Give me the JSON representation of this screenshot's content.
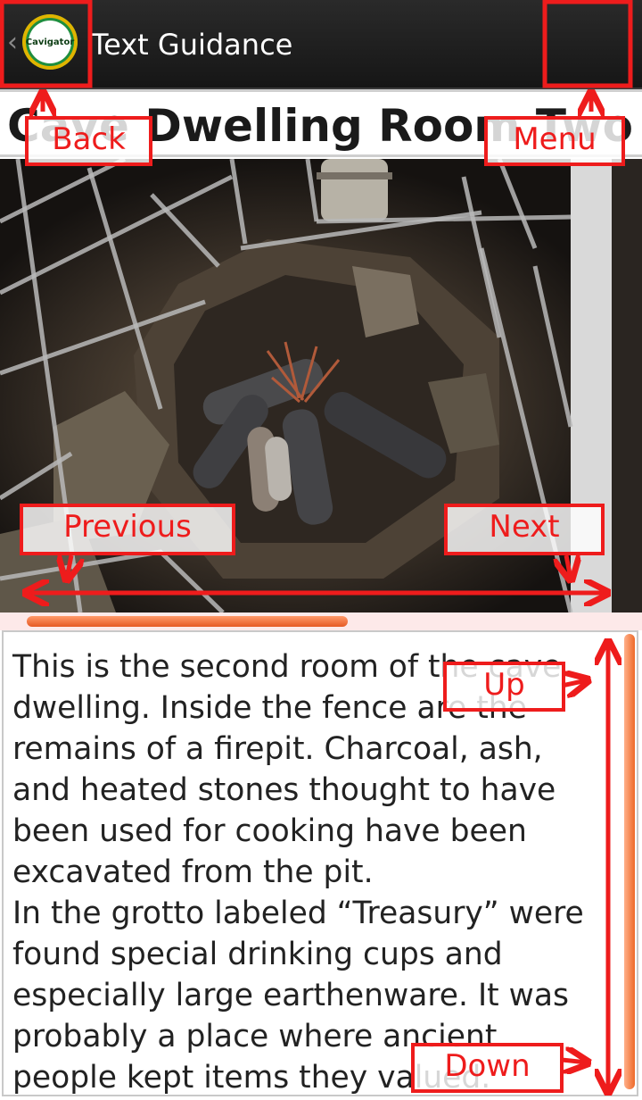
{
  "actionbar": {
    "title": "Text Guidance",
    "logo_text": "Cavigator",
    "back_icon": "chevron-left-icon",
    "menu_icon": "overflow-menu-icon"
  },
  "section": {
    "title": "Cave Dwelling Room Two (Fire"
  },
  "content": {
    "paragraph_1": "This is the second room of the cave dwelling. Inside the fence are the remains of a firepit. Charcoal, ash, and heated stones thought to have been used for cooking have been excavated from the pit.",
    "paragraph_2": "In the grotto labeled “Treasury” were found special drinking cups and especially large earthenware. It was probably a place where ancient people kept items they valued."
  },
  "annotations": {
    "back": "Back",
    "menu": "Menu",
    "previous": "Previous",
    "next": "Next",
    "up": "Up",
    "down": "Down"
  },
  "colors": {
    "annotation": "#ee1c1c",
    "actionbar": "#1f1f1f",
    "scroll_thumb": "#ee6a2a"
  }
}
